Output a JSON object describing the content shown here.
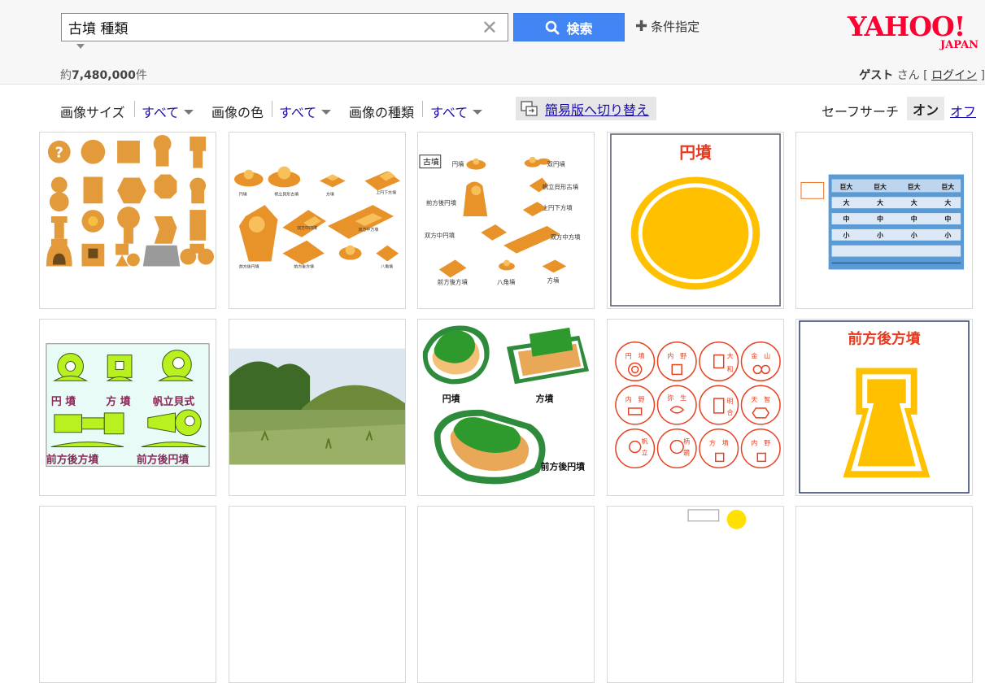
{
  "search": {
    "query": "古墳 種類",
    "button_label": "検索",
    "conditions_label": "条件指定"
  },
  "logo": {
    "name": "YAHOO!",
    "sub": "JAPAN"
  },
  "results": {
    "count": "7,480,000",
    "count_prefix": "約",
    "count_suffix": "件"
  },
  "user": {
    "guest": "ゲスト",
    "san": " さん [ ",
    "login": "ログイン",
    "close": " ]"
  },
  "filters": {
    "size_label": "画像サイズ",
    "size_value": "すべて",
    "color_label": "画像の色",
    "color_value": "すべて",
    "type_label": "画像の種類",
    "type_value": "すべて",
    "simple_switch": "簡易版へ切り替え",
    "safe_label": "セーフサーチ",
    "safe_on": "オン",
    "safe_off": "オフ"
  },
  "tiles": {
    "t2": {
      "labels": [
        "円墳",
        "帆立貝形古墳",
        "方墳",
        "上円下方墳",
        "前方後円墳",
        "双方中円墳",
        "双方中方墳",
        "前方後方墳",
        "八角墳"
      ]
    },
    "t3": {
      "title": "古墳",
      "labels": [
        "円墳",
        "双円墳",
        "帆立貝形古墳",
        "前方後円墳",
        "上円下方墳",
        "双方中円墳",
        "双方中方墳",
        "前方後方墳",
        "八角墳",
        "方墳"
      ]
    },
    "t4": {
      "title": "円墳"
    },
    "t5": {
      "heads": [
        "巨大",
        "巨大",
        "巨大",
        "巨大"
      ],
      "rows": [
        "大",
        "中",
        "小"
      ]
    },
    "t6": {
      "labels": [
        "円 墳",
        "方 墳",
        "帆立貝式",
        "前方後方墳",
        "前方後円墳"
      ]
    },
    "t8": {
      "labels": [
        "円墳",
        "方墳",
        "前方後円墳"
      ]
    },
    "t9": {
      "labels": [
        "円",
        "墳",
        "内",
        "野",
        "大",
        "和",
        "金",
        "山",
        "内",
        "野",
        "弥",
        "生",
        "明",
        "合",
        "天",
        "智",
        "帆",
        "立",
        "柄",
        "鏡",
        "方",
        "墳",
        "内",
        "野"
      ]
    },
    "t10": {
      "title": "前方後方墳"
    }
  },
  "colors": {
    "accent": "#4285f4",
    "orange": "#e9a040",
    "gold": "#ffc000",
    "red": "#e84020",
    "green": "#2e8b3c"
  }
}
